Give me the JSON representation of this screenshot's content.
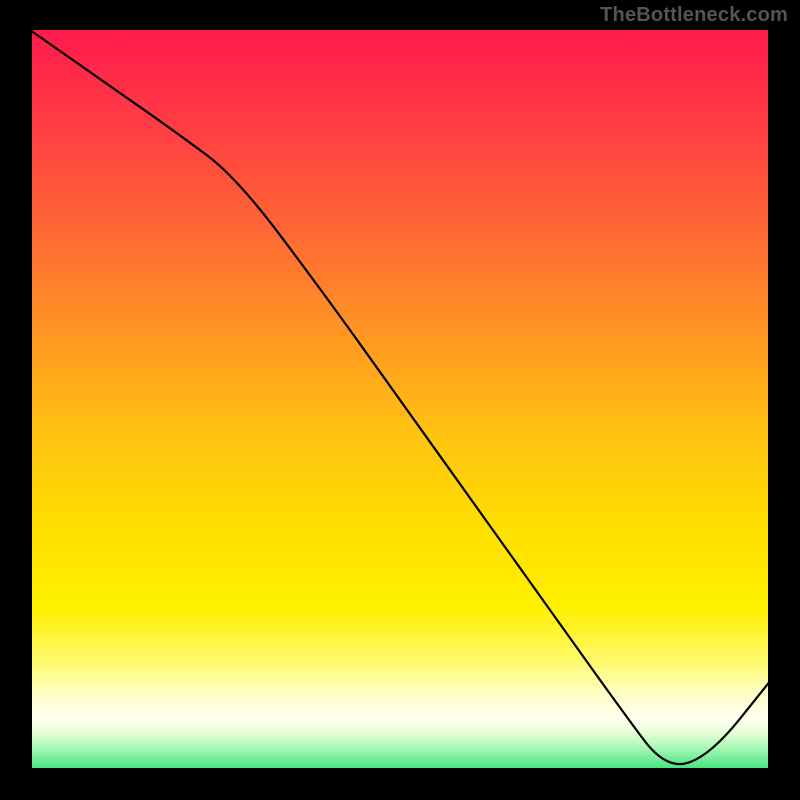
{
  "watermark": "TheBottleneck.com",
  "optimal_label": "",
  "chart_data": {
    "type": "line",
    "title": "",
    "xlabel": "",
    "ylabel": "",
    "x": [
      0,
      10,
      20,
      28,
      40,
      50,
      60,
      70,
      80,
      86,
      92,
      100
    ],
    "values": [
      100,
      93,
      86,
      80,
      64,
      50,
      36,
      22,
      8,
      0,
      2,
      12
    ],
    "xlim": [
      0,
      100
    ],
    "ylim": [
      0,
      100
    ],
    "minimum_x": 86,
    "minimum_y": 0,
    "notes": "Descending bottleneck curve over red-yellow-green gradient; minimum near x≈86%, rises again toward right edge."
  }
}
